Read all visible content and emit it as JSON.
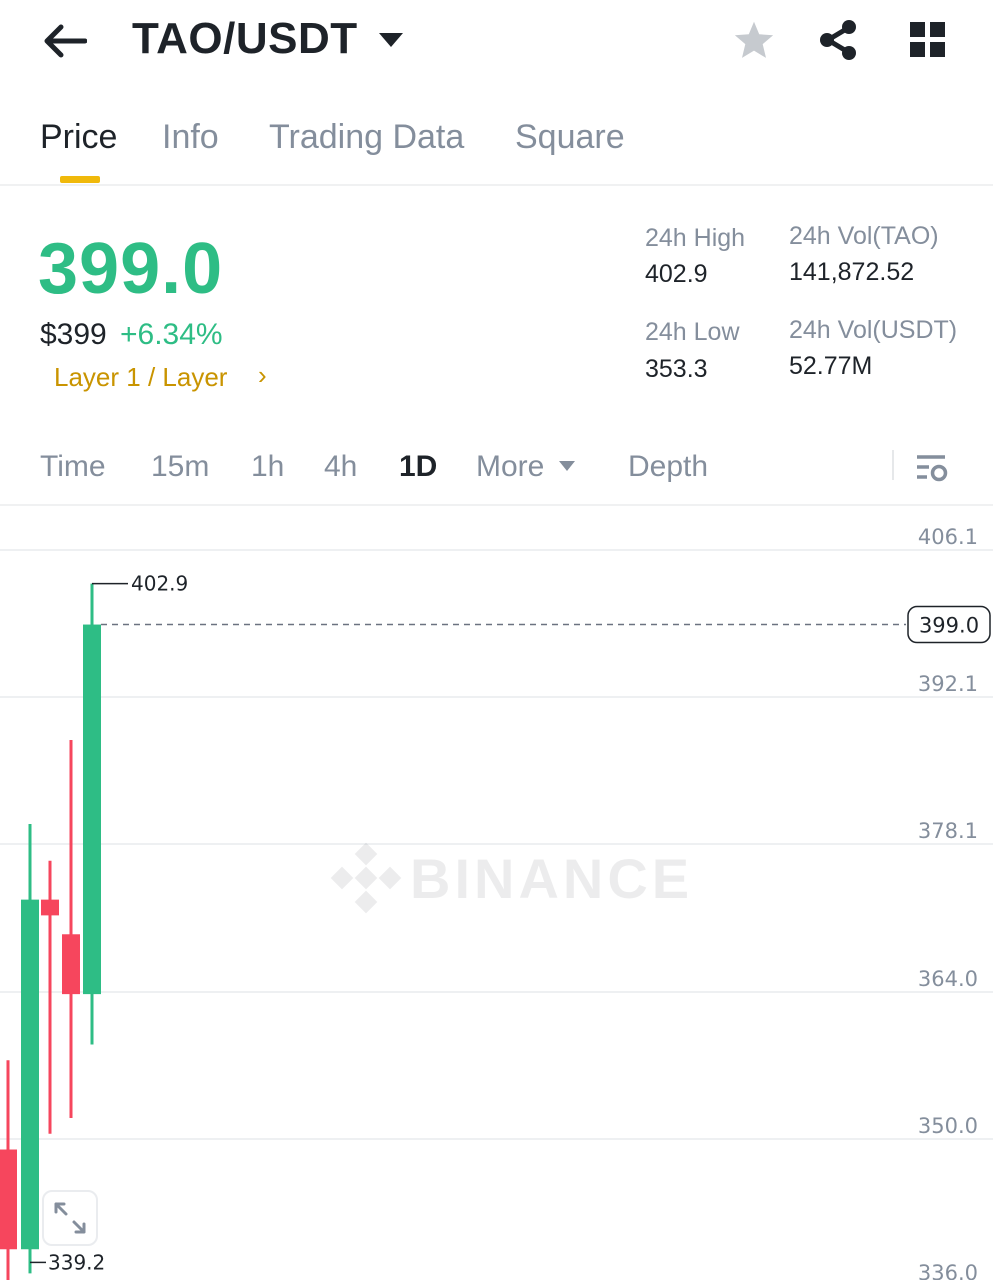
{
  "header": {
    "pair": "TAO/USDT",
    "icons": [
      "back-arrow-icon",
      "caret-down-icon",
      "star-icon",
      "share-icon",
      "grid-icon"
    ]
  },
  "tabs": [
    {
      "label": "Price",
      "active": true
    },
    {
      "label": "Info",
      "active": false
    },
    {
      "label": "Trading Data",
      "active": false
    },
    {
      "label": "Square",
      "active": false
    }
  ],
  "ticker": {
    "last_price": "399.0",
    "usd_price": "$399",
    "change_pct": "+6.34%",
    "tag": "Layer 1 / Layer",
    "tag_chevron": "›",
    "high_label": "24h High",
    "high_value": "402.9",
    "low_label": "24h Low",
    "low_value": "353.3",
    "vol_base_label": "24h Vol(TAO)",
    "vol_base_value": "141,872.52",
    "vol_quote_label": "24h Vol(USDT)",
    "vol_quote_value": "52.77M"
  },
  "intervals": {
    "items": [
      {
        "label": "Time",
        "active": false
      },
      {
        "label": "15m",
        "active": false
      },
      {
        "label": "1h",
        "active": false
      },
      {
        "label": "4h",
        "active": false
      },
      {
        "label": "1D",
        "active": true
      },
      {
        "label": "More",
        "active": false
      },
      {
        "label": "Depth",
        "active": false
      }
    ]
  },
  "chart": {
    "watermark": "BINANCE",
    "colors": {
      "up": "#2ebd85",
      "down": "#f6465d",
      "grid": "#eef0f2",
      "axis_text": "#848e9c"
    },
    "y_axis_labels": [
      "406.1",
      "392.1",
      "378.1",
      "364.0",
      "350.0",
      "336.0"
    ],
    "current_price_label": "399.0",
    "high_marker": "402.9",
    "low_marker": "339.2"
  },
  "chart_data": {
    "type": "candlestick",
    "ylim": [
      336.0,
      406.1
    ],
    "y_ticks": [
      406.1,
      392.1,
      378.1,
      364.0,
      350.0,
      336.0
    ],
    "candles": [
      {
        "open": 349.0,
        "high": 357.5,
        "low": 336.5,
        "close": 339.5,
        "dir": "down"
      },
      {
        "open": 339.5,
        "high": 380.0,
        "low": 337.2,
        "close": 372.8,
        "dir": "up"
      },
      {
        "open": 372.8,
        "high": 376.5,
        "low": 350.5,
        "close": 371.3,
        "dir": "down"
      },
      {
        "open": 369.5,
        "high": 388.0,
        "low": 352.0,
        "close": 363.8,
        "dir": "down"
      },
      {
        "open": 363.8,
        "high": 402.9,
        "low": 359.0,
        "close": 399.0,
        "dir": "up"
      }
    ],
    "last_price": 399.0,
    "high": 402.9,
    "low": 339.2
  }
}
